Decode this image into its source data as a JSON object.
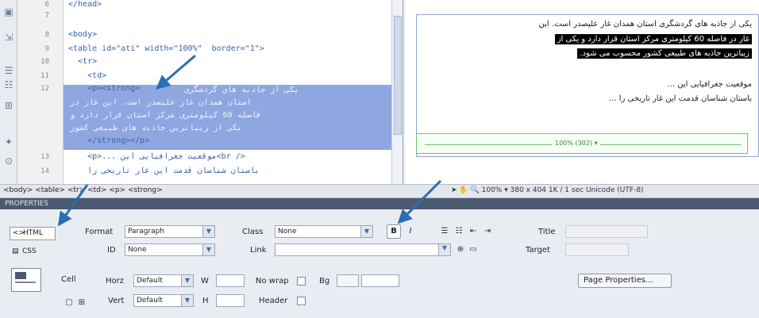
{
  "code": {
    "lines": [
      {
        "n": "6",
        "text": "</head>"
      },
      {
        "n": "7",
        "text": ""
      },
      {
        "n": "8",
        "text": "<body>"
      },
      {
        "n": "9",
        "text": "<table id=\"ati\" width=\"100%\"  border=\"1\">"
      },
      {
        "n": "10",
        "text": "  <tr>"
      },
      {
        "n": "11",
        "text": "    <td>"
      },
      {
        "n": "12",
        "text": "    <p><strong>"
      },
      {
        "n": "",
        "text": ""
      },
      {
        "n": "",
        "text": ""
      },
      {
        "n": "",
        "text": ""
      },
      {
        "n": "",
        "text": "    </strong></p>"
      },
      {
        "n": "13",
        "text": "    <p>... موقعیت جغرافیایی این<br />"
      },
      {
        "n": "14",
        "text": "    باستان شناسان قدمت این غار تاریخی را"
      }
    ],
    "selected_text": [
      "یکی از جاذبه های گردشگری",
      "استان همدان غار علیصدر است. این غار در",
      "فاصله 60 کیلومتری مرکز استان قرار دارد و",
      "یکی از زیباترین جاذبه های طبیعی کشور"
    ]
  },
  "design": {
    "lines": [
      "یکی از جاذبه های گردشگری استان همدان غار علیصدر است. این",
      "غار در فاصله 60 کیلومتری مرکز استان قرار دارد و یکی از",
      "زیباترین جاذبه های طبیعی کشور محسوب می شود.",
      "موقعیت جغرافیایی این ...",
      "باستان شناسان قدمت این غار تاریخی را ..."
    ],
    "width_label": "100% (302) ▾"
  },
  "status": {
    "tag_selector": "<body> <table> <tr> <td> <p> <strong>",
    "zoom": "100%",
    "dims": "380 x 404",
    "size": "1K / 1 sec",
    "encoding": "Unicode (UTF-8)"
  },
  "props": {
    "header": "PROPERTIES",
    "html_label": "HTML",
    "css_label": "CSS",
    "format_label": "Format",
    "format_value": "Paragraph",
    "id_label": "ID",
    "id_value": "None",
    "class_label": "Class",
    "class_value": "None",
    "link_label": "Link",
    "title_label": "Title",
    "target_label": "Target",
    "cell_label": "Cell",
    "horz_label": "Horz",
    "horz_value": "Default",
    "vert_label": "Vert",
    "vert_value": "Default",
    "w_label": "W",
    "h_label": "H",
    "nowrap_label": "No wrap",
    "header_label": "Header",
    "bg_label": "Bg",
    "page_props": "Page Properties...",
    "bold_label": "B",
    "italic_label": "I"
  },
  "colors": {
    "arrow": "#2a6fb0",
    "selection": "#8fa7e0"
  }
}
